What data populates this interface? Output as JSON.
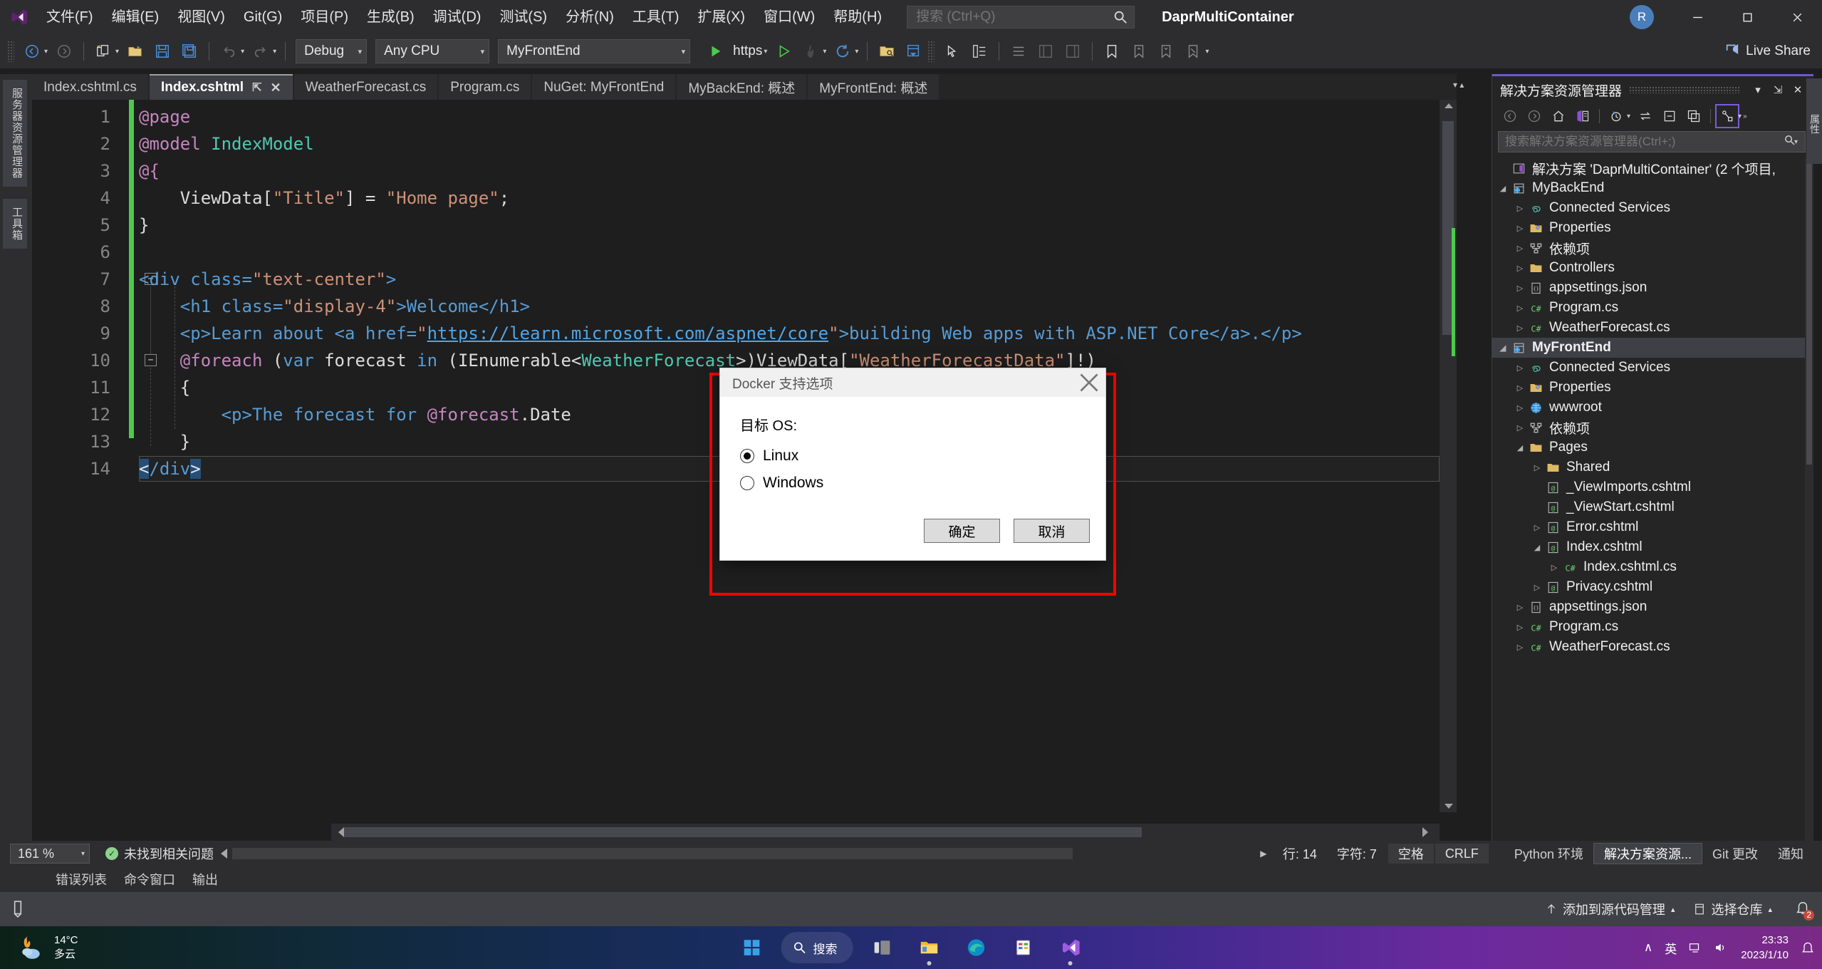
{
  "window": {
    "title": "DaprMultiContainer",
    "account_initial": "R",
    "minimize": "minimize-icon",
    "maximize": "maximize-icon",
    "close": "close-icon"
  },
  "menu": {
    "items": [
      {
        "label": "文件(F)"
      },
      {
        "label": "编辑(E)"
      },
      {
        "label": "视图(V)"
      },
      {
        "label": "Git(G)"
      },
      {
        "label": "项目(P)"
      },
      {
        "label": "生成(B)"
      },
      {
        "label": "调试(D)"
      },
      {
        "label": "测试(S)"
      },
      {
        "label": "分析(N)"
      },
      {
        "label": "工具(T)"
      },
      {
        "label": "扩展(X)"
      },
      {
        "label": "窗口(W)"
      },
      {
        "label": "帮助(H)"
      }
    ],
    "search_placeholder": "搜索 (Ctrl+Q)"
  },
  "toolbar": {
    "config": "Debug",
    "platform": "Any CPU",
    "startup_project": "MyFrontEnd",
    "run_label": "https",
    "live_share": "Live Share"
  },
  "tabs": [
    {
      "label": "Index.cshtml.cs",
      "active": false
    },
    {
      "label": "Index.cshtml",
      "active": true
    },
    {
      "label": "WeatherForecast.cs",
      "active": false
    },
    {
      "label": "Program.cs",
      "active": false
    },
    {
      "label": "NuGet: MyFrontEnd",
      "active": false
    },
    {
      "label": "MyBackEnd: 概述",
      "active": false
    },
    {
      "label": "MyFrontEnd: 概述",
      "active": false
    }
  ],
  "vertical_tabs": [
    {
      "label": "服务器资源管理器"
    },
    {
      "label": "工具箱"
    }
  ],
  "editor": {
    "lines": [
      {
        "n": "1"
      },
      {
        "n": "2"
      },
      {
        "n": "3"
      },
      {
        "n": "4"
      },
      {
        "n": "5"
      },
      {
        "n": "6"
      },
      {
        "n": "7"
      },
      {
        "n": "8"
      },
      {
        "n": "9"
      },
      {
        "n": "10"
      },
      {
        "n": "11"
      },
      {
        "n": "12"
      },
      {
        "n": "13"
      },
      {
        "n": "14"
      }
    ],
    "code": {
      "l1": "@page",
      "l2_at": "@model",
      "l2_type": "IndexModel",
      "l3": "@{",
      "l4_a": "    ViewData[",
      "l4_b": "\"Title\"",
      "l4_c": "] = ",
      "l4_d": "\"Home page\"",
      "l4_e": ";",
      "l5": "}",
      "l7_a": "<div class=",
      "l7_b": "\"text-center\"",
      "l7_c": ">",
      "l8_a": "    <h1 class=",
      "l8_b": "\"display-4\"",
      "l8_c": ">Welcome</h1>",
      "l9_a": "    <p>Learn about <a href=",
      "l9_q1": "\"",
      "l9_url": "https://learn.microsoft.com/aspnet/core",
      "l9_q2": "\"",
      "l9_b": ">building Web apps with ASP.NET Core</a>.</p>",
      "l10_a": "    @foreach",
      "l10_b": " (",
      "l10_var": "var",
      "l10_c": " forecast ",
      "l10_in": "in",
      "l10_d": " (IEnumerable<",
      "l10_type": "WeatherForecast",
      "l10_e": ">)ViewData[",
      "l10_str": "\"WeatherForecastData\"",
      "l10_f": "]!)",
      "l11": "    {",
      "l12_a": "        <p>The forecast for ",
      "l12_b": "@forecast",
      "l12_c": ".Date",
      "l13": "    }",
      "l14": "</div>"
    }
  },
  "dialog": {
    "title": "Docker 支持选项",
    "close_icon": "close-icon",
    "label": "目标 OS:",
    "options": [
      {
        "label": "Linux",
        "selected": true
      },
      {
        "label": "Windows",
        "selected": false
      }
    ],
    "ok_label": "确定",
    "cancel_label": "取消",
    "highlight_color": "#ff0000"
  },
  "solution_explorer": {
    "title": "解决方案资源管理器",
    "search_placeholder": "搜索解决方案资源管理器(Ctrl+;)",
    "right_tab_label": "属性",
    "tree": [
      {
        "label": "解决方案 'DaprMultiContainer' (2 个项目,",
        "depth": 0,
        "twisty": "",
        "icon": "solution-icon",
        "selected": false
      },
      {
        "label": "MyBackEnd",
        "depth": 0,
        "twisty": "▲",
        "icon": "project-web-icon",
        "selected": false
      },
      {
        "label": "Connected Services",
        "depth": 1,
        "twisty": "▶",
        "icon": "connected-services-icon",
        "selected": false
      },
      {
        "label": "Properties",
        "depth": 1,
        "twisty": "▶",
        "icon": "properties-icon",
        "selected": false
      },
      {
        "label": "依赖项",
        "depth": 1,
        "twisty": "▶",
        "icon": "dependencies-icon",
        "selected": false
      },
      {
        "label": "Controllers",
        "depth": 1,
        "twisty": "▶",
        "icon": "folder-icon",
        "selected": false
      },
      {
        "label": "appsettings.json",
        "depth": 1,
        "twisty": "▶",
        "icon": "json-icon",
        "selected": false
      },
      {
        "label": "Program.cs",
        "depth": 1,
        "twisty": "▶",
        "icon": "csharp-icon",
        "selected": false
      },
      {
        "label": "WeatherForecast.cs",
        "depth": 1,
        "twisty": "▶",
        "icon": "csharp-icon",
        "selected": false
      },
      {
        "label": "MyFrontEnd",
        "depth": 0,
        "twisty": "▲",
        "icon": "project-web-icon",
        "selected": true
      },
      {
        "label": "Connected Services",
        "depth": 1,
        "twisty": "▶",
        "icon": "connected-services-icon",
        "selected": false
      },
      {
        "label": "Properties",
        "depth": 1,
        "twisty": "▶",
        "icon": "properties-icon",
        "selected": false
      },
      {
        "label": "wwwroot",
        "depth": 1,
        "twisty": "▶",
        "icon": "globe-icon",
        "selected": false
      },
      {
        "label": "依赖项",
        "depth": 1,
        "twisty": "▶",
        "icon": "dependencies-icon",
        "selected": false
      },
      {
        "label": "Pages",
        "depth": 1,
        "twisty": "▲",
        "icon": "folder-icon",
        "selected": false
      },
      {
        "label": "Shared",
        "depth": 2,
        "twisty": "▶",
        "icon": "folder-icon",
        "selected": false
      },
      {
        "label": "_ViewImports.cshtml",
        "depth": 2,
        "twisty": "",
        "icon": "razor-icon",
        "selected": false
      },
      {
        "label": "_ViewStart.cshtml",
        "depth": 2,
        "twisty": "",
        "icon": "razor-icon",
        "selected": false
      },
      {
        "label": "Error.cshtml",
        "depth": 2,
        "twisty": "▶",
        "icon": "razor-icon",
        "selected": false
      },
      {
        "label": "Index.cshtml",
        "depth": 2,
        "twisty": "▲",
        "icon": "razor-icon",
        "selected": false
      },
      {
        "label": "Index.cshtml.cs",
        "depth": 3,
        "twisty": "▶",
        "icon": "csharp-icon",
        "selected": false
      },
      {
        "label": "Privacy.cshtml",
        "depth": 2,
        "twisty": "▶",
        "icon": "razor-icon",
        "selected": false
      },
      {
        "label": "appsettings.json",
        "depth": 1,
        "twisty": "▶",
        "icon": "json-icon",
        "selected": false
      },
      {
        "label": "Program.cs",
        "depth": 1,
        "twisty": "▶",
        "icon": "csharp-icon",
        "selected": false
      },
      {
        "label": "WeatherForecast.cs",
        "depth": 1,
        "twisty": "▶",
        "icon": "csharp-icon",
        "selected": false
      }
    ]
  },
  "status_bar": {
    "zoom": "161 %",
    "issues": "未找到相关问题",
    "line_label": "行: 14",
    "char_label": "字符: 7",
    "spaces": "空格",
    "eol": "CRLF",
    "panes": [
      {
        "label": "Python 环境",
        "active": false
      },
      {
        "label": "解决方案资源...",
        "active": true
      },
      {
        "label": "Git 更改",
        "active": false
      },
      {
        "label": "通知",
        "active": false
      }
    ]
  },
  "bottom_tabs": [
    {
      "label": "错误列表"
    },
    {
      "label": "命令窗口"
    },
    {
      "label": "输出"
    }
  ],
  "source_control_bar": {
    "add_to_source_control": "添加到源代码管理",
    "select_repo": "选择仓库",
    "notification_count": "2"
  },
  "taskbar": {
    "weather_temp": "14°C",
    "weather_desc": "多云",
    "search_label": "搜索",
    "lang": "英",
    "time": "23:33",
    "date": "2023/1/10",
    "apps": [
      {
        "name": "start-icon"
      },
      {
        "name": "task-view-icon"
      },
      {
        "name": "file-explorer-icon"
      },
      {
        "name": "edge-icon"
      },
      {
        "name": "store-icon"
      },
      {
        "name": "visual-studio-icon"
      }
    ]
  }
}
